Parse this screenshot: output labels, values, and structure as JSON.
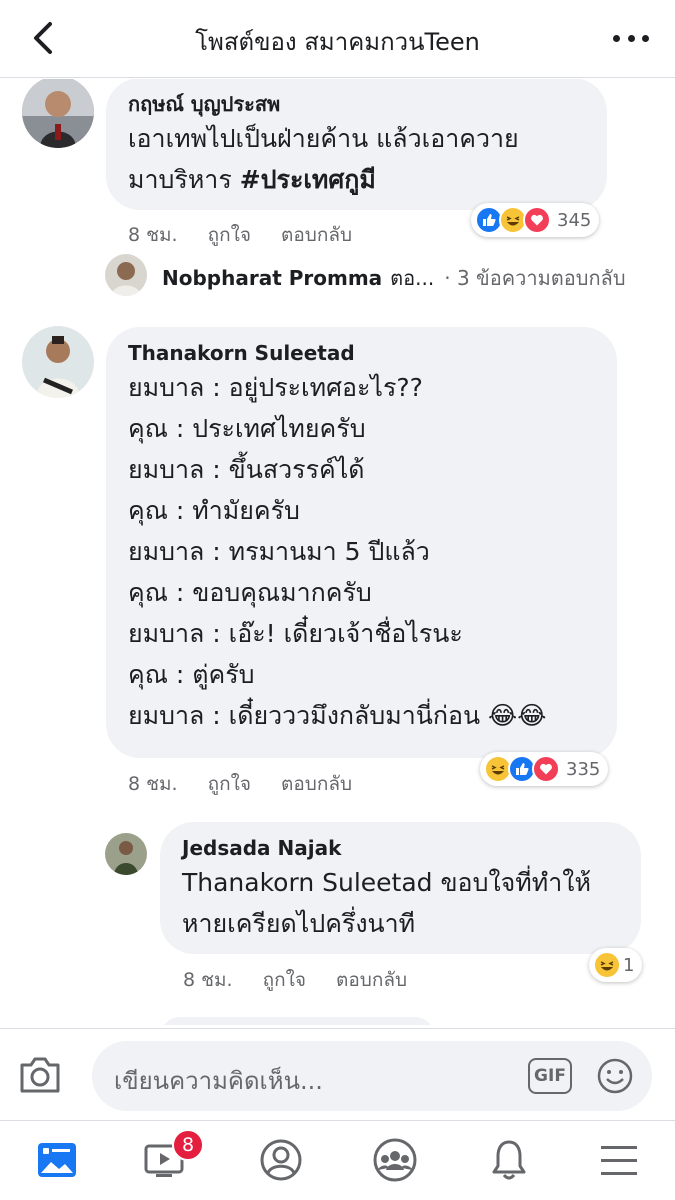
{
  "header": {
    "title": "โพสต์ของ สมาคมกวนTeen"
  },
  "comments": [
    {
      "name": "กฤษณ์ บุญประสพ",
      "text_main": "เอาเทพไปเป็นฝ่ายค้าน แล้วเอาควาย\nมาบริหาร ",
      "hashtag": "#ประเทศกูมี",
      "time": "8 ชม.",
      "like_label": "ถูกใจ",
      "reply_label": "ตอบกลับ",
      "reactions": [
        "like",
        "haha",
        "love"
      ],
      "reaction_count": "345",
      "replies_preview": {
        "name": "Nobpharat Promma",
        "snippet": "ตอ...",
        "count_text": "· 3 ข้อความตอบกลับ"
      }
    },
    {
      "name": "Thanakorn Suleetad",
      "text_main": "ยมบาล : อยู่ประเทศอะไร??\nคุณ : ประเทศไทยครับ\nยมบาล : ขึ้นสวรรค์ได้\nคุณ : ทำมัยครับ\nยมบาล : ทรมานมา 5 ปีแล้ว\nคุณ :  ขอบคุณมากครับ\nยมบาล : เอ๊ะ! เดี๋ยวเจ้าชื่อไรนะ\nคุณ : ตู่ครับ\nยมบาล : เดี๋ยวววมึงกลับมานี่ก่อน ",
      "emoji_tail": "😂😂",
      "time": "8 ชม.",
      "like_label": "ถูกใจ",
      "reply_label": "ตอบกลับ",
      "reactions": [
        "haha",
        "like",
        "love"
      ],
      "reaction_count": "335"
    },
    {
      "name": "Jedsada Najak",
      "text_main": "Thanakorn Suleetad ขอบใจที่ทำให้\nหายเครียดไปครึ่งนาที",
      "time": "8 ชม.",
      "like_label": "ถูกใจ",
      "reply_label": "ตอบกลับ",
      "reactions": [
        "haha"
      ],
      "reaction_count": "1"
    }
  ],
  "composer": {
    "placeholder": "เขียนความคิดเห็น...",
    "gif_label": "GIF"
  },
  "tabbar": {
    "video_badge": "8"
  },
  "colors": {
    "bubble": "#f0f2f5",
    "like": "#1877f2",
    "love": "#f33e58",
    "haha": "#f7c437",
    "active_tab": "#1877f2"
  }
}
